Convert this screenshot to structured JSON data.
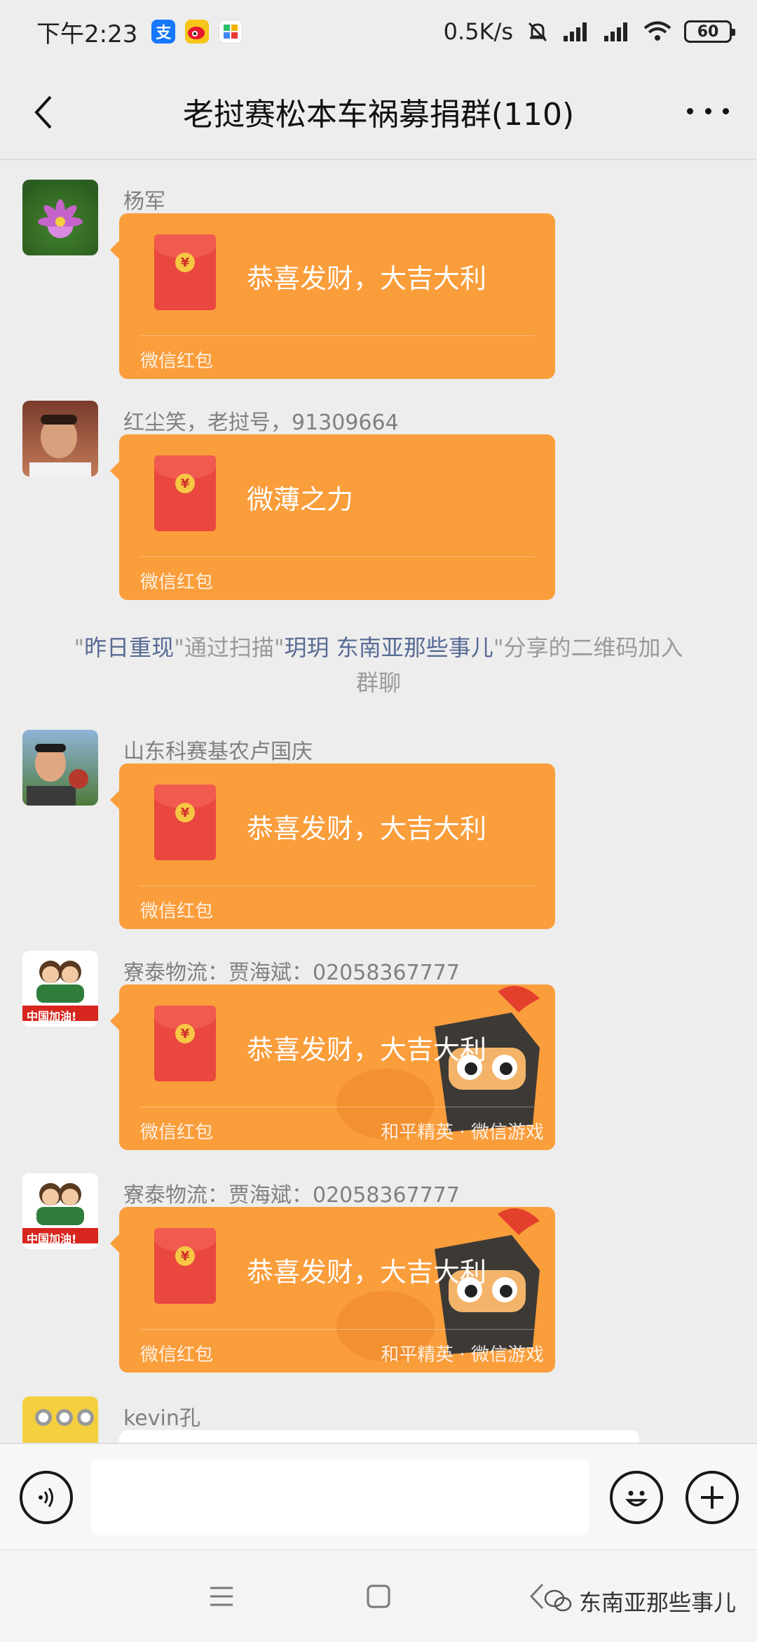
{
  "status_bar": {
    "time": "下午2:23",
    "net_speed": "0.5K/s",
    "battery": "60"
  },
  "header": {
    "title": "老挝赛松本车祸募捐群(110)"
  },
  "messages": [
    {
      "sender": "杨军",
      "wish": "恭喜发财，大吉大利",
      "label": "微信红包"
    },
    {
      "sender": "红尘笑，老挝号，91309664",
      "wish": "微薄之力",
      "label": "微信红包"
    },
    {
      "sender": "山东科赛基农卢国庆",
      "wish": "恭喜发财，大吉大利",
      "label": "微信红包"
    },
    {
      "sender": "寮泰物流：贾海斌：02058367777",
      "wish": "恭喜发财，大吉大利",
      "label": "微信红包",
      "brand": "和平精英 · 微信游戏"
    },
    {
      "sender": "寮泰物流：贾海斌：02058367777",
      "wish": "恭喜发财，大吉大利",
      "label": "微信红包",
      "brand": "和平精英 · 微信游戏"
    },
    {
      "sender": "kevin孔"
    }
  ],
  "system_note": {
    "q1": "\"",
    "user": "昨日重现",
    "mid": "\"通过扫描\"",
    "inviter": "玥玥 东南亚那些事儿",
    "end": "\"分享的二维码加入群聊"
  },
  "avatar_badge": "中国加油!",
  "watermark": "东南亚那些事儿",
  "colors": {
    "packet": "#fa9d3b",
    "envelope": "#e9473f",
    "link": "#576b95"
  }
}
